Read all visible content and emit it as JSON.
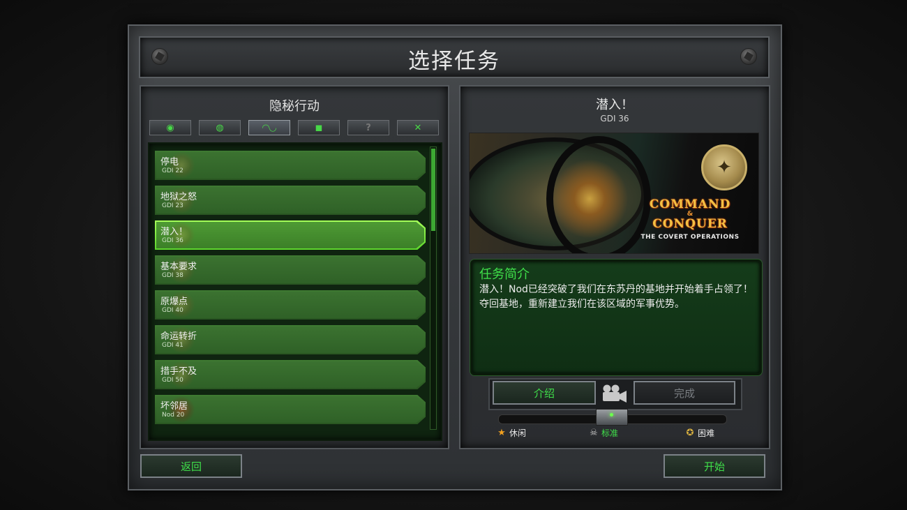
{
  "header": {
    "title": "选择任务"
  },
  "left_panel": {
    "campaign_title": "隐秘行动",
    "category_tabs": [
      {
        "icon": "gdi-eagle-icon",
        "glyph": "◉",
        "active": false,
        "enabled": true
      },
      {
        "icon": "nod-scorpion-icon",
        "glyph": "◍",
        "active": false,
        "enabled": true
      },
      {
        "icon": "covert-goggles-icon",
        "glyph": "◠◡",
        "active": true,
        "enabled": true
      },
      {
        "icon": "gamepad-icon",
        "glyph": "◼",
        "active": false,
        "enabled": true
      },
      {
        "icon": "unknown-icon",
        "glyph": "?",
        "active": false,
        "enabled": false
      },
      {
        "icon": "tools-icon",
        "glyph": "✕",
        "active": false,
        "enabled": true
      }
    ],
    "missions": [
      {
        "name": "停电",
        "code": "GDI 22",
        "faction": "gdi",
        "selected": false
      },
      {
        "name": "地狱之怒",
        "code": "GDI 23",
        "faction": "gdi",
        "selected": false
      },
      {
        "name": "潜入！",
        "code": "GDI 36",
        "faction": "gdi",
        "selected": true
      },
      {
        "name": "基本要求",
        "code": "GDI 38",
        "faction": "gdi",
        "selected": false
      },
      {
        "name": "原爆点",
        "code": "GDI 40",
        "faction": "gdi",
        "selected": false
      },
      {
        "name": "命运转折",
        "code": "GDI 41",
        "faction": "gdi",
        "selected": false
      },
      {
        "name": "措手不及",
        "code": "GDI 50",
        "faction": "gdi",
        "selected": false
      },
      {
        "name": "坏邻居",
        "code": "Nod 20",
        "faction": "nod",
        "selected": false
      }
    ],
    "scroll_position": 0
  },
  "right_panel": {
    "mission_title": "潜入！",
    "mission_code": "GDI 36",
    "preview_logo": {
      "line1": "COMMAND",
      "line2": "&",
      "line3": "CONQUER",
      "line4": "THE COVERT OPERATIONS"
    },
    "briefing": {
      "heading": "任务简介",
      "text": "潜入！Nod已经突破了我们在东苏丹的基地并开始着手占领了！夺回基地，重新建立我们在该区域的军事优势。"
    },
    "intro_button": "介绍",
    "complete_button": "完成",
    "difficulty": {
      "options": [
        {
          "label": "休闲",
          "icon": "star-icon",
          "color": "#e8e8e8",
          "icon_color": "#f0a020"
        },
        {
          "label": "标准",
          "icon": "skull-icon",
          "color": "#3fe04a",
          "icon_color": "#bfbfbf"
        },
        {
          "label": "困难",
          "icon": "emblem-icon",
          "color": "#e8e8e8",
          "icon_color": "#d8b040"
        }
      ],
      "selected": "标准"
    }
  },
  "footer": {
    "back_button": "返回",
    "start_button": "开始"
  },
  "colors": {
    "accent_green": "#3fe04a",
    "list_green": "#326528",
    "frame_gray": "#3a3d40"
  }
}
